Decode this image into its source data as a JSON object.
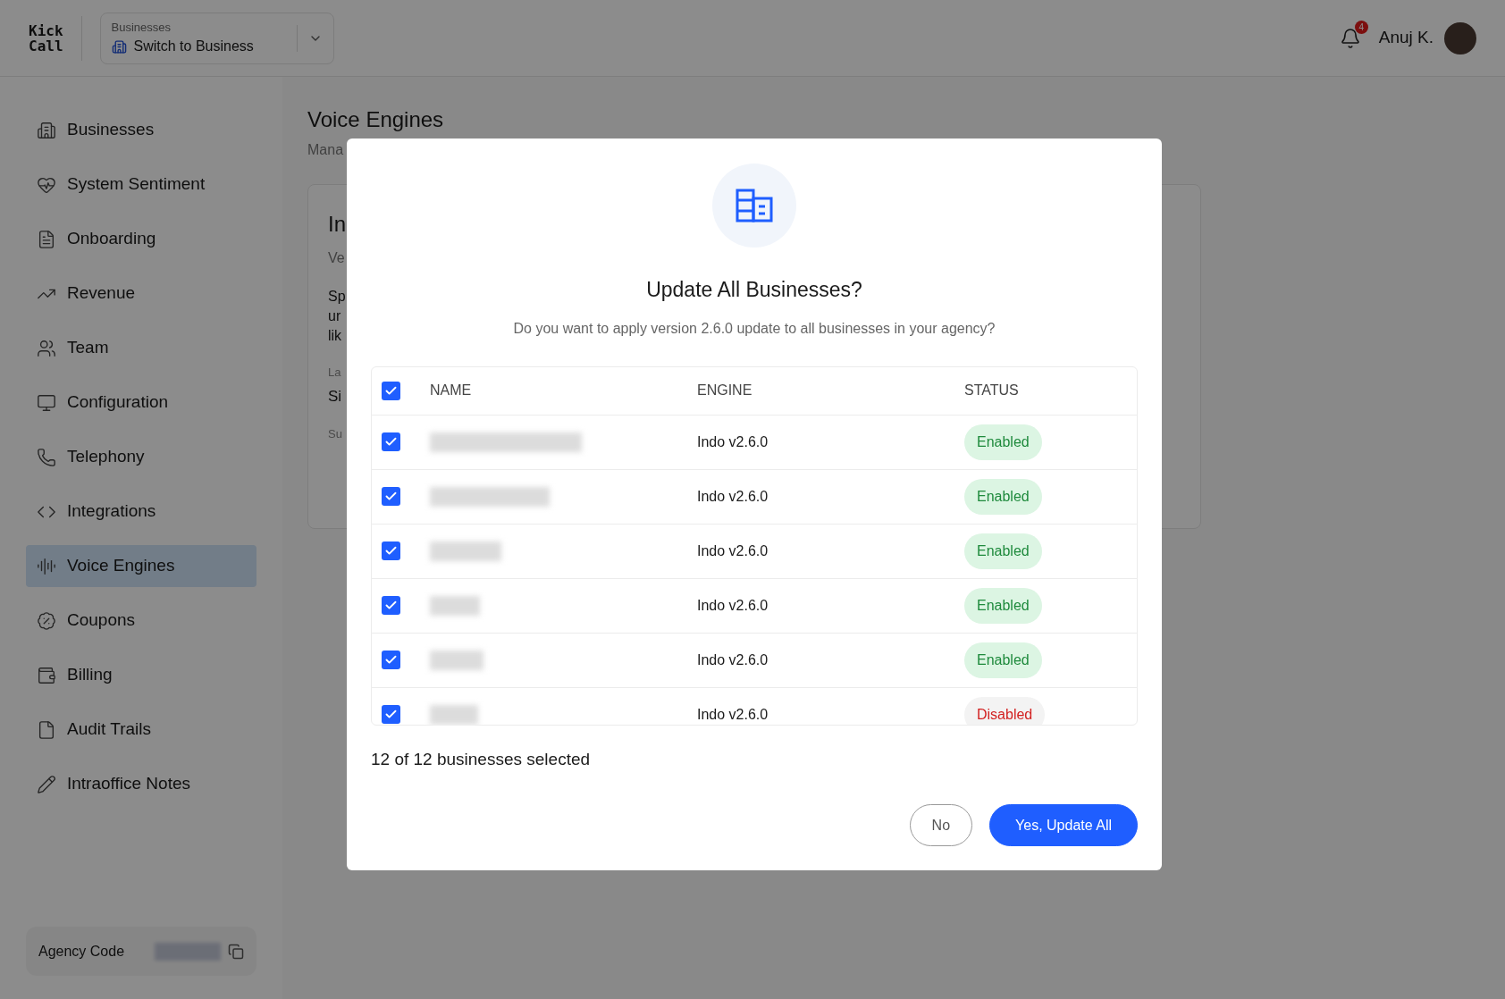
{
  "topbar": {
    "logo": [
      "Kick",
      "Call"
    ],
    "switcher": {
      "label": "Businesses",
      "value": "Switch to Business"
    },
    "notifications": {
      "count": "4"
    },
    "user": {
      "name": "Anuj K."
    }
  },
  "sidebar": {
    "items": [
      {
        "label": "Businesses",
        "selected": false
      },
      {
        "label": "System Sentiment",
        "selected": false
      },
      {
        "label": "Onboarding",
        "selected": false
      },
      {
        "label": "Revenue",
        "selected": false
      },
      {
        "label": "Team",
        "selected": false
      },
      {
        "label": "Configuration",
        "selected": false
      },
      {
        "label": "Telephony",
        "selected": false
      },
      {
        "label": "Integrations",
        "selected": false
      },
      {
        "label": "Voice Engines",
        "selected": true
      },
      {
        "label": "Coupons",
        "selected": false
      },
      {
        "label": "Billing",
        "selected": false
      },
      {
        "label": "Audit Trails",
        "selected": false
      },
      {
        "label": "Intraoffice Notes",
        "selected": false
      }
    ],
    "agency_code": {
      "label": "Agency Code"
    }
  },
  "page": {
    "title": "Voice Engines",
    "subtitle": "Mana",
    "card": {
      "title": "In",
      "version": "Ve",
      "description": [
        "Sp",
        "ur",
        "lik"
      ],
      "field_label": "La",
      "field_value": "Si",
      "section_label": "Su"
    }
  },
  "dialog": {
    "title": "Update All Businesses?",
    "message": "Do you want to apply version 2.6.0 update to all businesses in your agency?",
    "table": {
      "columns": [
        "NAME",
        "ENGINE",
        "STATUS"
      ],
      "all_checked": true,
      "rows": [
        {
          "checked": true,
          "engine": "Indo v2.6.0",
          "status": {
            "kind": "enabled",
            "label": "Enabled"
          }
        },
        {
          "checked": true,
          "engine": "Indo v2.6.0",
          "status": {
            "kind": "enabled",
            "label": "Enabled"
          }
        },
        {
          "checked": true,
          "engine": "Indo v2.6.0",
          "status": {
            "kind": "enabled",
            "label": "Enabled"
          }
        },
        {
          "checked": true,
          "engine": "Indo v2.6.0",
          "status": {
            "kind": "enabled",
            "label": "Enabled"
          }
        },
        {
          "checked": true,
          "engine": "Indo v2.6.0",
          "status": {
            "kind": "enabled",
            "label": "Enabled"
          }
        },
        {
          "checked": true,
          "engine": "Indo v2.6.0",
          "status": {
            "kind": "disabled",
            "label": "Disabled"
          }
        }
      ]
    },
    "selection_summary": "12 of 12 businesses selected",
    "buttons": [
      {
        "label": "No",
        "kind": "secondary"
      },
      {
        "label": "Yes, Update All",
        "kind": "primary"
      }
    ]
  }
}
